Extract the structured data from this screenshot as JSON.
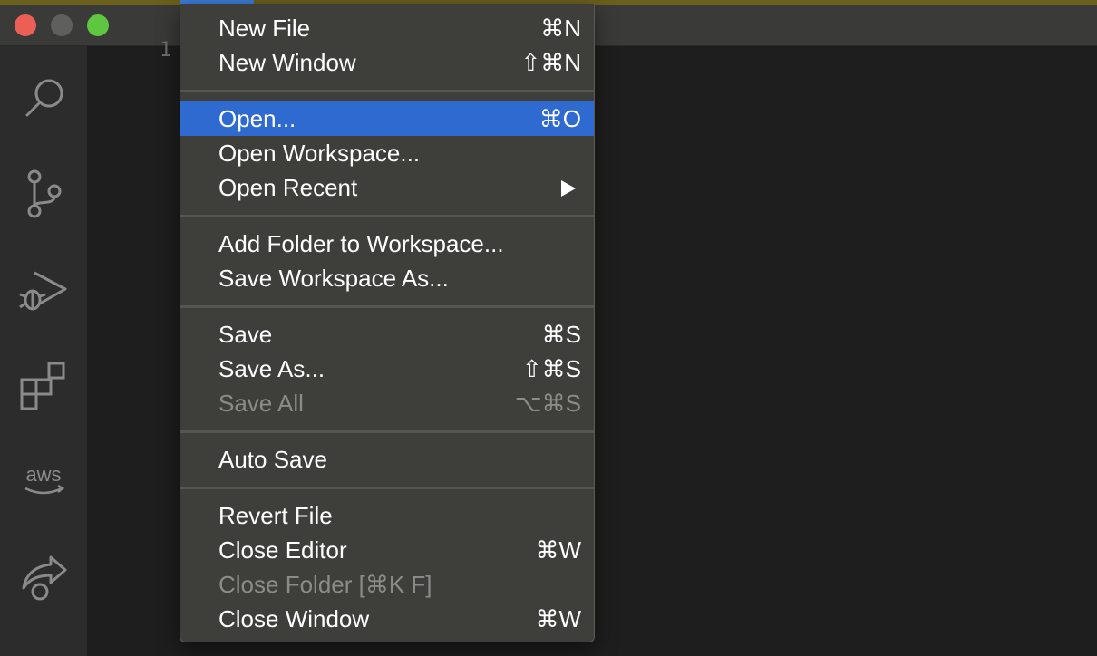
{
  "window": {
    "traffic_lights": [
      "close",
      "minimize",
      "zoom"
    ],
    "colors": {
      "close": "#ec5f57",
      "minimize": "#5f5f5e",
      "zoom": "#5ec640"
    }
  },
  "activity_bar": {
    "icons": [
      "search-icon",
      "source-control-icon",
      "run-debug-icon",
      "extensions-icon",
      "aws-icon",
      "live-share-icon"
    ],
    "aws_label": "aws"
  },
  "editor": {
    "line_number": "1"
  },
  "file_menu": {
    "accent": "#2f6ad0",
    "items": [
      {
        "label": "New File",
        "shortcut": "⌘N"
      },
      {
        "label": "New Window",
        "shortcut": "⇧⌘N"
      },
      {
        "label": "Open...",
        "shortcut": "⌘O",
        "selected": true
      },
      {
        "label": "Open Workspace...",
        "shortcut": ""
      },
      {
        "label": "Open Recent",
        "shortcut": "",
        "submenu": true
      },
      {
        "label": "Add Folder to Workspace...",
        "shortcut": ""
      },
      {
        "label": "Save Workspace As...",
        "shortcut": ""
      },
      {
        "label": "Save",
        "shortcut": "⌘S"
      },
      {
        "label": "Save As...",
        "shortcut": "⇧⌘S"
      },
      {
        "label": "Save All",
        "shortcut": "⌥⌘S",
        "disabled": true
      },
      {
        "label": "Auto Save",
        "shortcut": ""
      },
      {
        "label": "Revert File",
        "shortcut": ""
      },
      {
        "label": "Close Editor",
        "shortcut": "⌘W"
      },
      {
        "label": "Close Folder [⌘K F]",
        "shortcut": "",
        "disabled": true
      },
      {
        "label": "Close Window",
        "shortcut": "⌘W"
      }
    ]
  }
}
